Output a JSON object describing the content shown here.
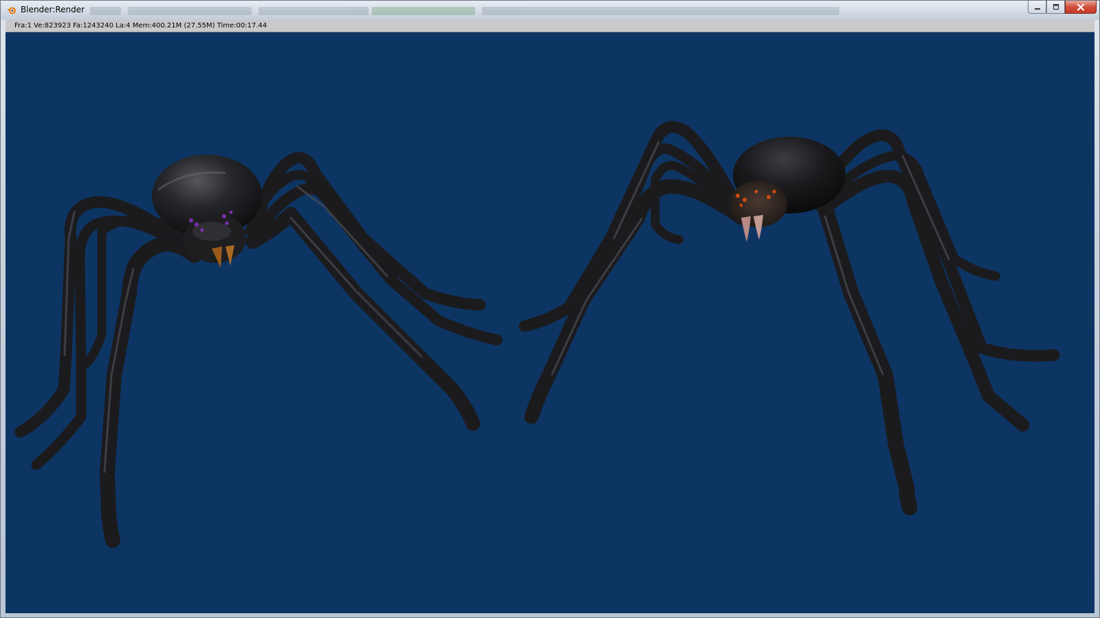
{
  "window": {
    "title": "Blender:Render",
    "controls": [
      "minimize-icon",
      "maximize-icon",
      "close-icon"
    ]
  },
  "render_stats": {
    "text": "Fra:1  Ve:823923  Fa:1243240  La:4  Mem:400.21M (27.55M)  Time:00:17.44"
  },
  "colors": {
    "viewport_bg": "#0d3564",
    "spider_body": "#1b1b1e",
    "spider_highlight": "#4a4c52",
    "fang_left": "#9a5a1a",
    "fang_right": "#b88a86",
    "eyes_left": "#7a2fb0",
    "eyes_right": "#d24a12"
  }
}
